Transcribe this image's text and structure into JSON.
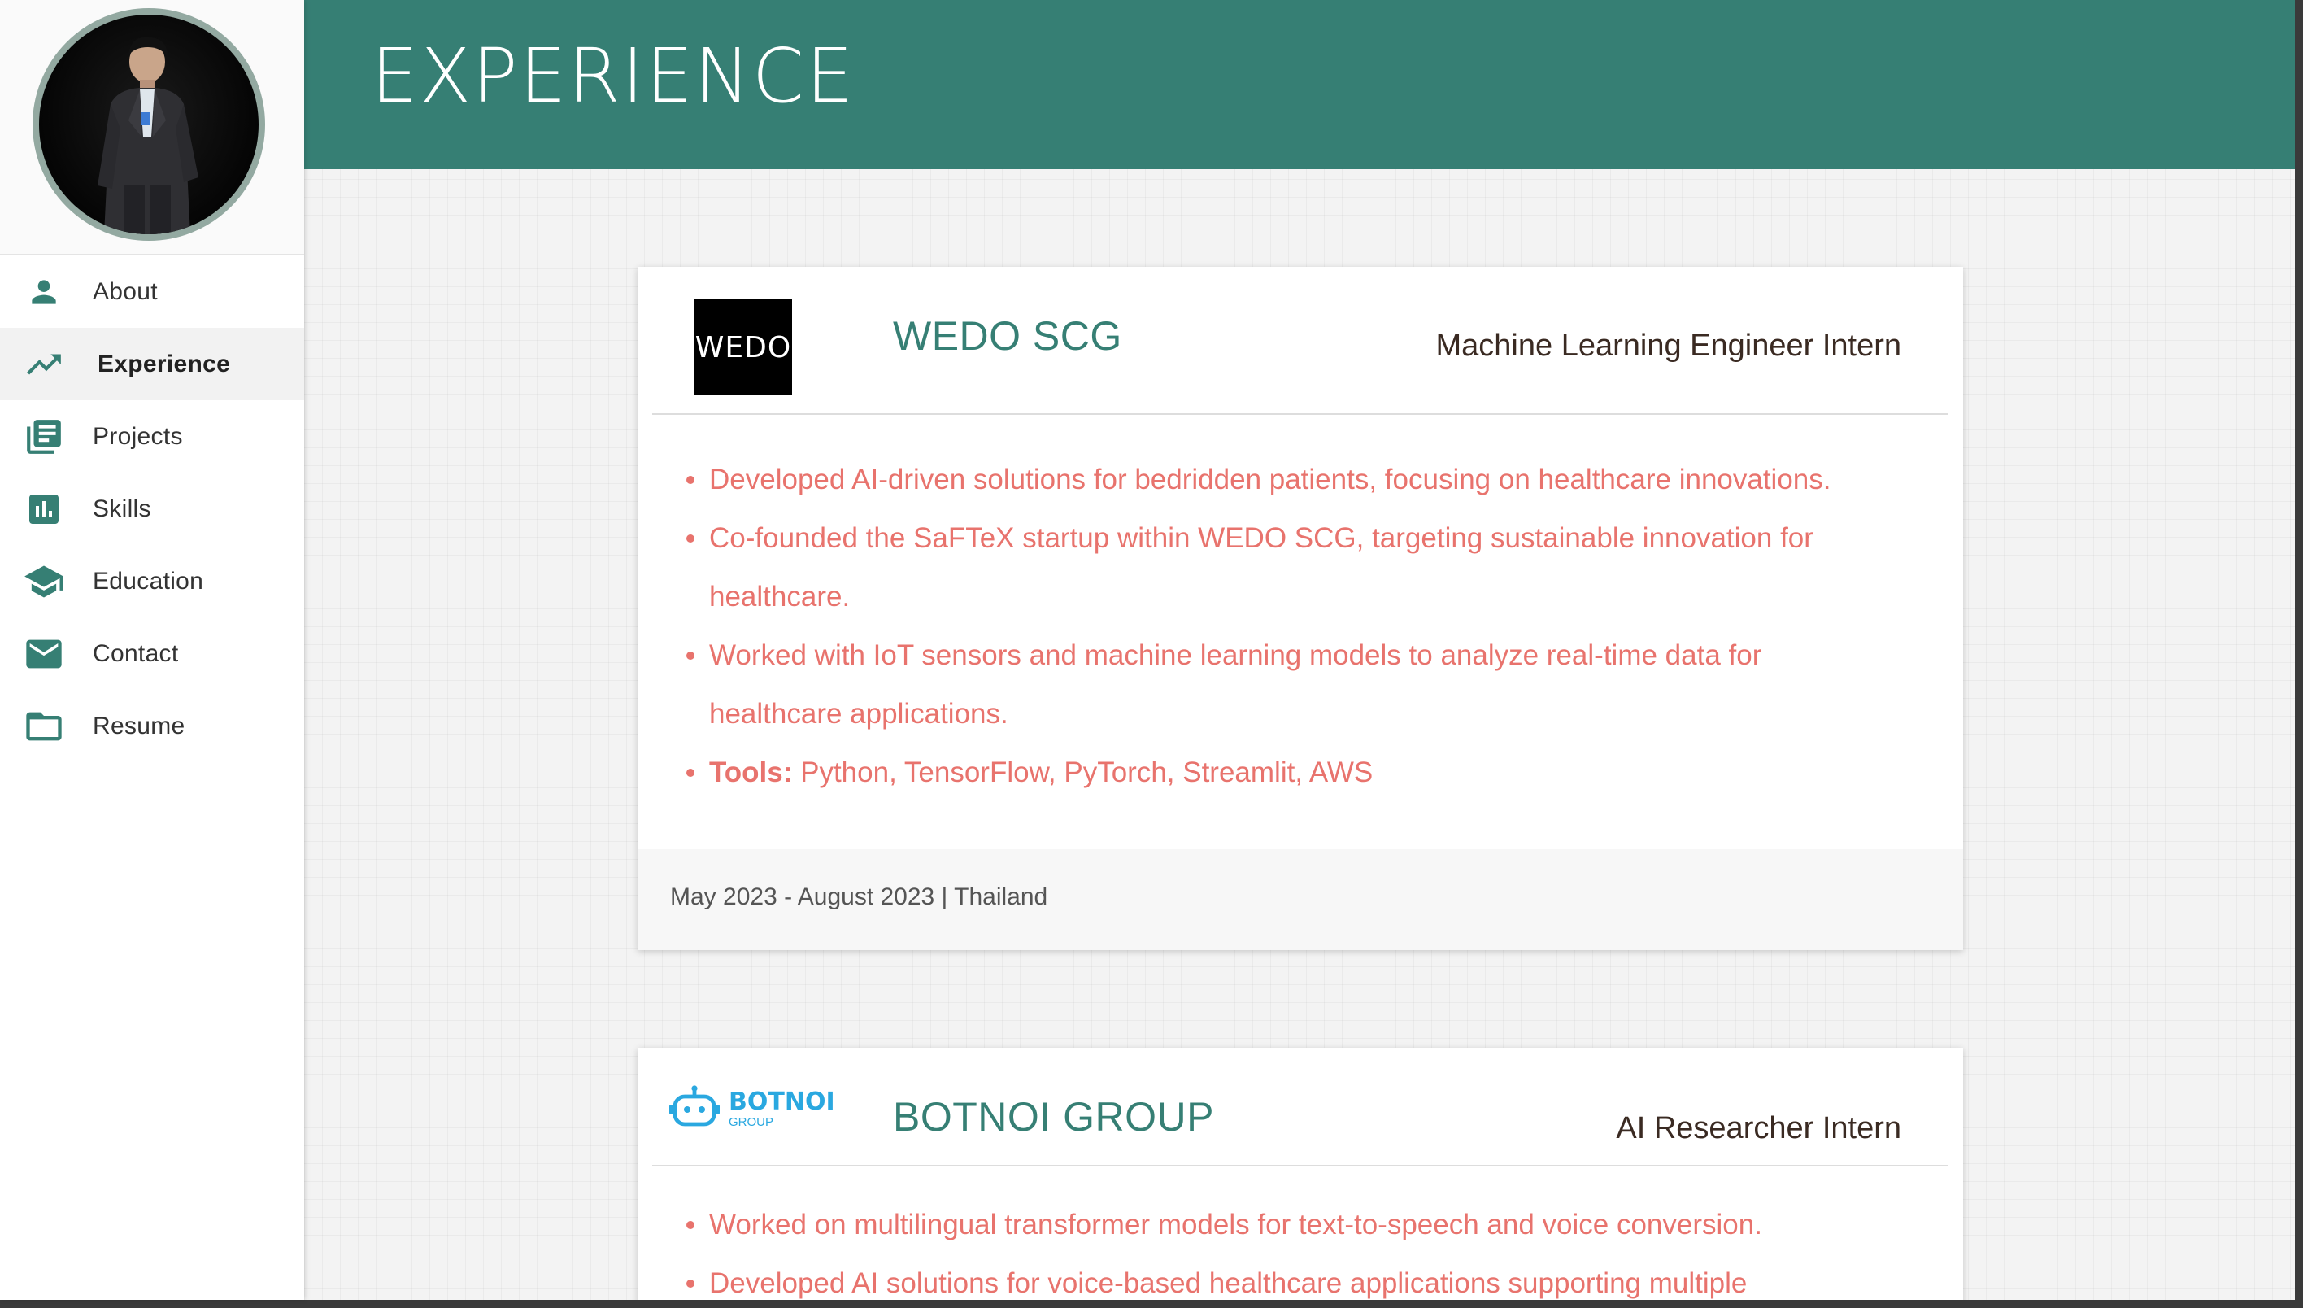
{
  "sidebar": {
    "items": [
      {
        "label": "About",
        "icon": "person-icon"
      },
      {
        "label": "Experience",
        "icon": "trending-up-icon",
        "active": true
      },
      {
        "label": "Projects",
        "icon": "library-books-icon"
      },
      {
        "label": "Skills",
        "icon": "bar-chart-icon"
      },
      {
        "label": "Education",
        "icon": "school-icon"
      },
      {
        "label": "Contact",
        "icon": "mail-icon"
      },
      {
        "label": "Resume",
        "icon": "folder-icon"
      }
    ]
  },
  "header": {
    "title": "EXPERIENCE"
  },
  "colors": {
    "accent": "#367f74",
    "bullet_text": "#e8736d",
    "role_text": "#3a2a22",
    "avatar_ring": "#93a9a1"
  },
  "experience": [
    {
      "logo_text": "WEDO",
      "company": "WEDO SCG",
      "role": "Machine Learning Engineer Intern",
      "bullets": [
        "Developed AI-driven solutions for bedridden patients, focusing on healthcare innovations.",
        "Co-founded the SaFTeX startup within WEDO SCG, targeting sustainable innovation for healthcare.",
        "Worked with IoT sensors and machine learning models to analyze real-time data for healthcare applications."
      ],
      "tools_label": "Tools:",
      "tools": " Python, TensorFlow, PyTorch, Streamlit, AWS",
      "footer": "May 2023 - August 2023 | Thailand"
    },
    {
      "logo_text": "BOTNOI",
      "logo_sub": "GROUP",
      "company": "BOTNOI GROUP",
      "role": "AI Researcher Intern",
      "bullets": [
        "Worked on multilingual transformer models for text-to-speech and voice conversion.",
        "Developed AI solutions for voice-based healthcare applications supporting multiple"
      ]
    }
  ]
}
